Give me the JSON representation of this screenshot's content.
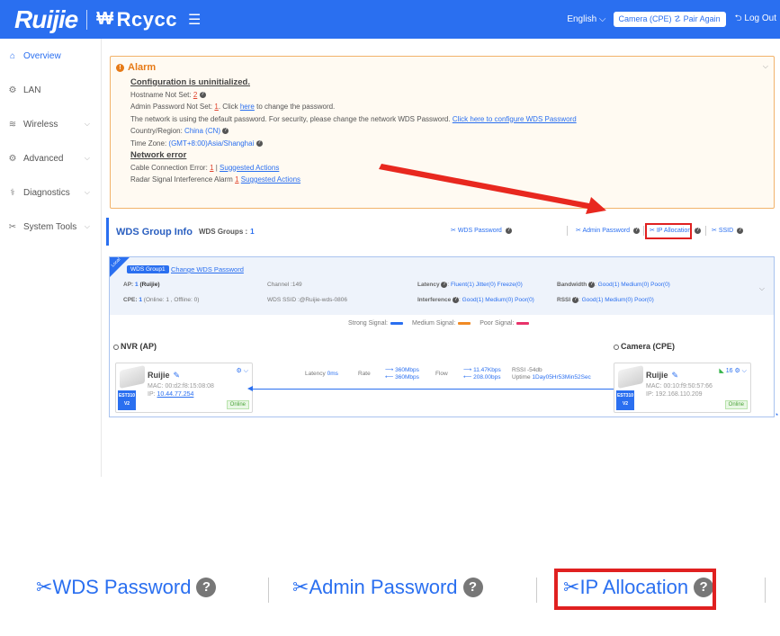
{
  "header": {
    "logo": "Ruijie",
    "brand": "Rcycc",
    "brand_mark": "₩",
    "menu_icon": "menu-icon",
    "language": "English",
    "mode_button": "Camera (CPE) ☡ Pair Again",
    "logout": "Log Out"
  },
  "sidebar": {
    "items": [
      {
        "label": "Overview",
        "icon": "home-icon",
        "active": true
      },
      {
        "label": "LAN",
        "icon": "lan-icon",
        "active": false
      },
      {
        "label": "Wireless",
        "icon": "wifi-icon",
        "active": false
      },
      {
        "label": "Advanced",
        "icon": "gear-icon",
        "active": false
      },
      {
        "label": "Diagnostics",
        "icon": "diagnostics-icon",
        "active": false
      },
      {
        "label": "System Tools",
        "icon": "tools-icon",
        "active": false
      }
    ]
  },
  "alarm": {
    "title": "Alarm",
    "config_heading": "Configuration is uninitialized.",
    "hostname_label": "Hostname Not Set:",
    "hostname_count": "2",
    "admin_pw_label": "Admin Password Not Set:",
    "admin_pw_count": "1",
    "admin_pw_text1": ". Click",
    "admin_pw_link": "here",
    "admin_pw_text2": "to change the password.",
    "network_pw_text": "The network is using the default password. For security, please change the network WDS Password.",
    "network_pw_link": "Click here to configure WDS Password",
    "country_label": "Country/Region:",
    "country_value": "China (CN)",
    "timezone_label": "Time Zone:",
    "timezone_value": "(GMT+8:00)Asia/Shanghai",
    "network_error_heading": "Network error",
    "cable_label": "Cable Connection Error:",
    "cable_count": "1",
    "cable_link": "Suggested Actions",
    "radar_label": "Radar Signal Interference Alarm",
    "radar_count": "1",
    "radar_link": "Suggested Actions"
  },
  "wds": {
    "title": "WDS Group Info",
    "groups_label": "WDS Groups :",
    "groups_count": "1",
    "actions": {
      "wds_password": "WDS Password",
      "admin_password": "Admin Password",
      "ip_allocation": "IP Allocation",
      "ssid": "SSID"
    },
    "group": {
      "corner": "Local",
      "tag": "WDS Group1",
      "change_link": "Change WDS Password",
      "ap_label": "AP:",
      "ap_count": "1",
      "ap_name": "(Ruijie)",
      "cpe_label": "CPE:",
      "cpe_count": "1",
      "cpe_online": "(Online: 1 , Offline: 0)",
      "channel": "Channel :149",
      "wds_ssid": "WDS SSID :@Ruijie-wds-0806",
      "latency_label": "Latency",
      "latency_values": "Fluent(1)  Jitter(0)  Freeze(0)",
      "interference_label": "Interference",
      "interference_values": "Good(1)  Medium(0)  Poor(0)",
      "bandwidth_label": "Bandwidth",
      "bandwidth_values": "Good(1)  Medium(0)  Poor(0)",
      "rssi_label": "RSSI",
      "rssi_values": "Good(1)  Medium(0)  Poor(0)"
    },
    "legend": {
      "strong": "Strong Signal:",
      "medium": "Medium Signal:",
      "poor": "Poor Signal:",
      "strong_color": "#2a6ff0",
      "medium_color": "#f08a24",
      "poor_color": "#e8336a"
    },
    "nvr": {
      "title": "NVR (AP)",
      "name": "Ruijie",
      "mac": "MAC:  00:d2:f8:15:08:08",
      "ip_label": "IP:",
      "ip": "10.44.77.254",
      "model": "EST310 V2",
      "status": "Online"
    },
    "camera": {
      "title": "Camera (CPE)",
      "name": "Ruijie",
      "mac": "MAC:  00:10:f9:50:57:66",
      "ip": "IP:  192.168.110.209",
      "model": "EST310 V2",
      "status": "Online",
      "signal": "16"
    },
    "link": {
      "latency_label": "Latency",
      "latency_value": "0ms",
      "rate_label": "Rate",
      "rate_up": "360Mbps",
      "rate_down": "360Mbps",
      "flow_label": "Flow",
      "flow_up": "11.47Kbps",
      "flow_down": "208.00bps",
      "rssi": "RSSI -54db",
      "uptime_label": "Uptime",
      "uptime_value": "1Day05Hr53Min52Sec"
    }
  },
  "zoom": {
    "wds_password": "WDS Password",
    "admin_password": "Admin Password",
    "ip_allocation": "IP Allocation"
  },
  "colors": {
    "header_bg": "#2a6ff0",
    "accent": "#2a6ff0",
    "alarm_border": "#f2b36b",
    "highlight": "#e02020"
  }
}
